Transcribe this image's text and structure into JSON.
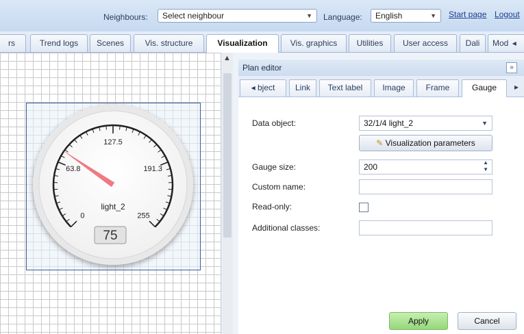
{
  "topbar": {
    "neighbours_label": "Neighbours:",
    "neighbours_value": "Select neighbour",
    "language_label": "Language:",
    "language_value": "English",
    "start_page": "Start page",
    "logout": "Logout"
  },
  "tabs": [
    "rs",
    "Trend logs",
    "Scenes",
    "Vis. structure",
    "Visualization",
    "Vis. graphics",
    "Utilities",
    "User access",
    "Dali",
    "Mod"
  ],
  "gauge": {
    "ticks": [
      "0",
      "63.8",
      "127.5",
      "191.3",
      "255"
    ],
    "name": "light_2",
    "value_text": "75",
    "value": 75,
    "min": 0,
    "max": 255
  },
  "plan_editor": {
    "title": "Plan editor",
    "collapse": "»",
    "tabs": [
      "bject",
      "Link",
      "Text label",
      "Image",
      "Frame",
      "Gauge"
    ],
    "tab_left_arrow": "◂",
    "tab_right_arrow": "▸",
    "fields": {
      "data_object_label": "Data object:",
      "data_object_value": "32/1/4 light_2",
      "vis_params_button": "Visualization parameters",
      "gauge_size_label": "Gauge size:",
      "gauge_size_value": "200",
      "custom_name_label": "Custom name:",
      "custom_name_value": "",
      "read_only_label": "Read-only:",
      "additional_classes_label": "Additional classes:",
      "additional_classes_value": ""
    },
    "apply_button": "Apply",
    "cancel_button": "Cancel"
  },
  "colors": {
    "needle": "#f07a84",
    "apply_bg": "#a8e08f",
    "header_bg": "#c6d9f0"
  }
}
